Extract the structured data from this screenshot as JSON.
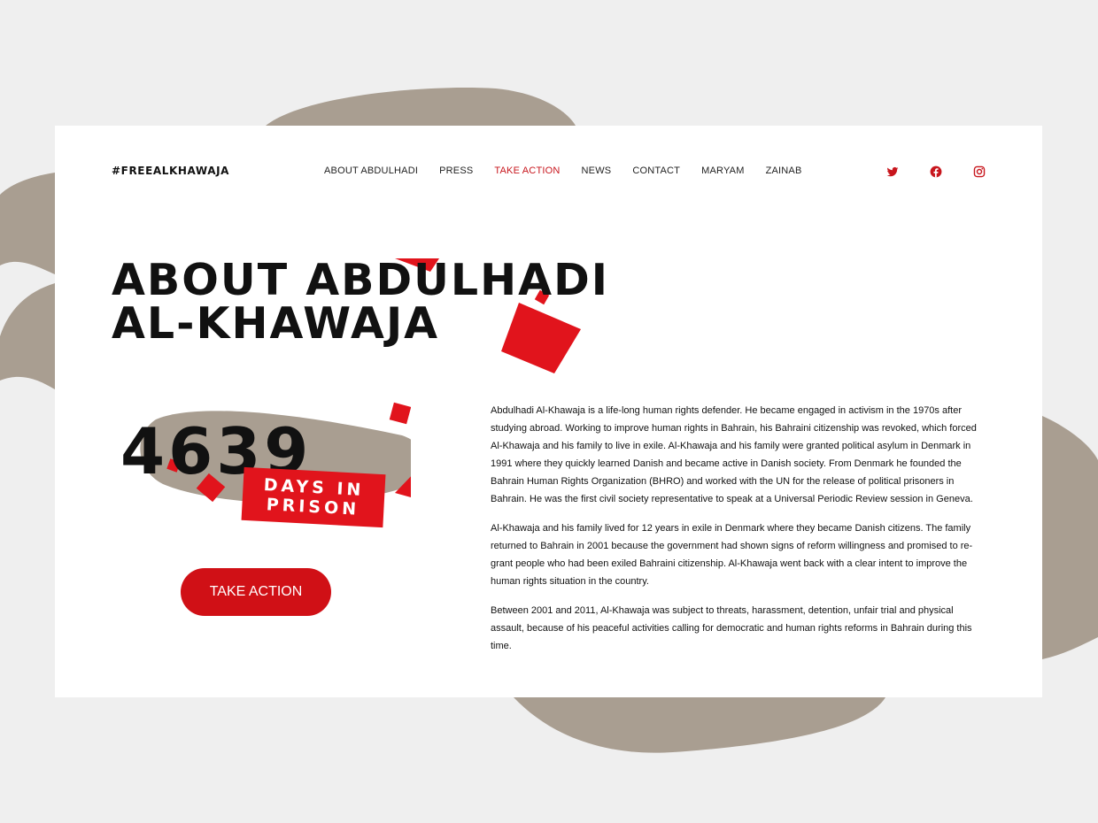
{
  "header": {
    "logo": "#FREEALKHAWAJA",
    "nav": [
      "ABOUT ABDULHADI",
      "PRESS",
      "TAKE ACTION",
      "NEWS",
      "CONTACT",
      "MARYAM",
      "ZAINAB"
    ],
    "active_nav": "TAKE ACTION",
    "social_icons": [
      "twitter-icon",
      "facebook-icon",
      "instagram-icon"
    ]
  },
  "hero": {
    "title_line1": "ABOUT ABDULHADI",
    "title_line2": "AL-KHAWAJA"
  },
  "counter": {
    "days": "4639",
    "label_line1": "DAYS IN",
    "label_line2": "PRISON"
  },
  "cta": {
    "label": "TAKE ACTION"
  },
  "paragraphs": [
    "Abdulhadi Al-Khawaja is a life-long human rights defender. He became engaged in activism in the 1970s after studying abroad. Working to improve human rights in Bahrain, his Bahraini citizenship was revoked, which forced Al-Khawaja and his family to live in exile. Al-Khawaja and his family were granted political asylum in Denmark in 1991 where they quickly learned Danish and became active in Danish society. From Denmark he founded the Bahrain Human Rights Organization (BHRO) and worked with the UN for the release of political prisoners in Bahrain. He was the first civil society representative to speak at a Universal Periodic Review session in Geneva.",
    "Al-Khawaja and his family lived for 12 years in exile in Denmark where they became Danish citizens. The family returned to Bahrain in 2001 because the government had shown signs of reform willingness and promised to re-grant people who had been exiled Bahraini citizenship. Al-Khawaja went back with a clear intent to improve the human rights situation in the country.",
    "Between 2001 and 2011, Al-Khawaja was subject to threats, harassment, detention, unfair trial and physical assault, because of his peaceful activities calling for democratic and human rights reforms in Bahrain during this time."
  ],
  "colors": {
    "accent": "#d01016",
    "brush": "#a99e91",
    "background": "#efefef",
    "card": "#ffffff",
    "text": "#111111"
  }
}
